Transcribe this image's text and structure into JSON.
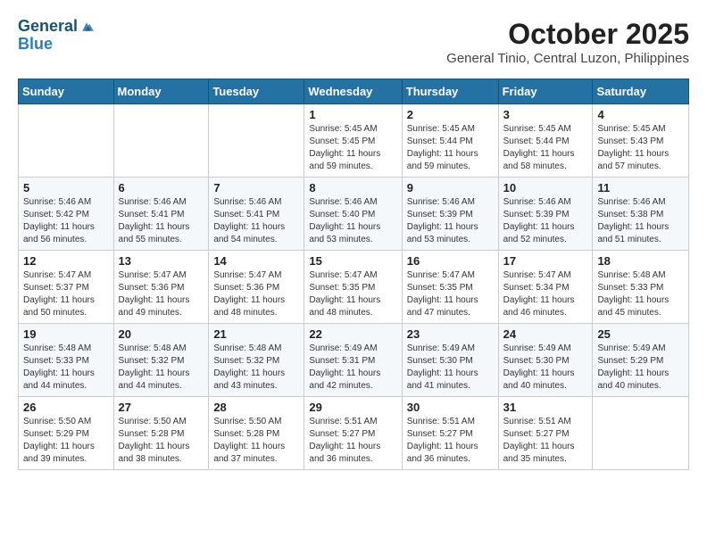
{
  "header": {
    "logo_line1": "General",
    "logo_line2": "Blue",
    "title": "October 2025",
    "subtitle": "General Tinio, Central Luzon, Philippines"
  },
  "days_of_week": [
    "Sunday",
    "Monday",
    "Tuesday",
    "Wednesday",
    "Thursday",
    "Friday",
    "Saturday"
  ],
  "weeks": [
    [
      {
        "day": "",
        "info": ""
      },
      {
        "day": "",
        "info": ""
      },
      {
        "day": "",
        "info": ""
      },
      {
        "day": "1",
        "info": "Sunrise: 5:45 AM\nSunset: 5:45 PM\nDaylight: 11 hours\nand 59 minutes."
      },
      {
        "day": "2",
        "info": "Sunrise: 5:45 AM\nSunset: 5:44 PM\nDaylight: 11 hours\nand 59 minutes."
      },
      {
        "day": "3",
        "info": "Sunrise: 5:45 AM\nSunset: 5:44 PM\nDaylight: 11 hours\nand 58 minutes."
      },
      {
        "day": "4",
        "info": "Sunrise: 5:45 AM\nSunset: 5:43 PM\nDaylight: 11 hours\nand 57 minutes."
      }
    ],
    [
      {
        "day": "5",
        "info": "Sunrise: 5:46 AM\nSunset: 5:42 PM\nDaylight: 11 hours\nand 56 minutes."
      },
      {
        "day": "6",
        "info": "Sunrise: 5:46 AM\nSunset: 5:41 PM\nDaylight: 11 hours\nand 55 minutes."
      },
      {
        "day": "7",
        "info": "Sunrise: 5:46 AM\nSunset: 5:41 PM\nDaylight: 11 hours\nand 54 minutes."
      },
      {
        "day": "8",
        "info": "Sunrise: 5:46 AM\nSunset: 5:40 PM\nDaylight: 11 hours\nand 53 minutes."
      },
      {
        "day": "9",
        "info": "Sunrise: 5:46 AM\nSunset: 5:39 PM\nDaylight: 11 hours\nand 53 minutes."
      },
      {
        "day": "10",
        "info": "Sunrise: 5:46 AM\nSunset: 5:39 PM\nDaylight: 11 hours\nand 52 minutes."
      },
      {
        "day": "11",
        "info": "Sunrise: 5:46 AM\nSunset: 5:38 PM\nDaylight: 11 hours\nand 51 minutes."
      }
    ],
    [
      {
        "day": "12",
        "info": "Sunrise: 5:47 AM\nSunset: 5:37 PM\nDaylight: 11 hours\nand 50 minutes."
      },
      {
        "day": "13",
        "info": "Sunrise: 5:47 AM\nSunset: 5:36 PM\nDaylight: 11 hours\nand 49 minutes."
      },
      {
        "day": "14",
        "info": "Sunrise: 5:47 AM\nSunset: 5:36 PM\nDaylight: 11 hours\nand 48 minutes."
      },
      {
        "day": "15",
        "info": "Sunrise: 5:47 AM\nSunset: 5:35 PM\nDaylight: 11 hours\nand 48 minutes."
      },
      {
        "day": "16",
        "info": "Sunrise: 5:47 AM\nSunset: 5:35 PM\nDaylight: 11 hours\nand 47 minutes."
      },
      {
        "day": "17",
        "info": "Sunrise: 5:47 AM\nSunset: 5:34 PM\nDaylight: 11 hours\nand 46 minutes."
      },
      {
        "day": "18",
        "info": "Sunrise: 5:48 AM\nSunset: 5:33 PM\nDaylight: 11 hours\nand 45 minutes."
      }
    ],
    [
      {
        "day": "19",
        "info": "Sunrise: 5:48 AM\nSunset: 5:33 PM\nDaylight: 11 hours\nand 44 minutes."
      },
      {
        "day": "20",
        "info": "Sunrise: 5:48 AM\nSunset: 5:32 PM\nDaylight: 11 hours\nand 44 minutes."
      },
      {
        "day": "21",
        "info": "Sunrise: 5:48 AM\nSunset: 5:32 PM\nDaylight: 11 hours\nand 43 minutes."
      },
      {
        "day": "22",
        "info": "Sunrise: 5:49 AM\nSunset: 5:31 PM\nDaylight: 11 hours\nand 42 minutes."
      },
      {
        "day": "23",
        "info": "Sunrise: 5:49 AM\nSunset: 5:30 PM\nDaylight: 11 hours\nand 41 minutes."
      },
      {
        "day": "24",
        "info": "Sunrise: 5:49 AM\nSunset: 5:30 PM\nDaylight: 11 hours\nand 40 minutes."
      },
      {
        "day": "25",
        "info": "Sunrise: 5:49 AM\nSunset: 5:29 PM\nDaylight: 11 hours\nand 40 minutes."
      }
    ],
    [
      {
        "day": "26",
        "info": "Sunrise: 5:50 AM\nSunset: 5:29 PM\nDaylight: 11 hours\nand 39 minutes."
      },
      {
        "day": "27",
        "info": "Sunrise: 5:50 AM\nSunset: 5:28 PM\nDaylight: 11 hours\nand 38 minutes."
      },
      {
        "day": "28",
        "info": "Sunrise: 5:50 AM\nSunset: 5:28 PM\nDaylight: 11 hours\nand 37 minutes."
      },
      {
        "day": "29",
        "info": "Sunrise: 5:51 AM\nSunset: 5:27 PM\nDaylight: 11 hours\nand 36 minutes."
      },
      {
        "day": "30",
        "info": "Sunrise: 5:51 AM\nSunset: 5:27 PM\nDaylight: 11 hours\nand 36 minutes."
      },
      {
        "day": "31",
        "info": "Sunrise: 5:51 AM\nSunset: 5:27 PM\nDaylight: 11 hours\nand 35 minutes."
      },
      {
        "day": "",
        "info": ""
      }
    ]
  ]
}
